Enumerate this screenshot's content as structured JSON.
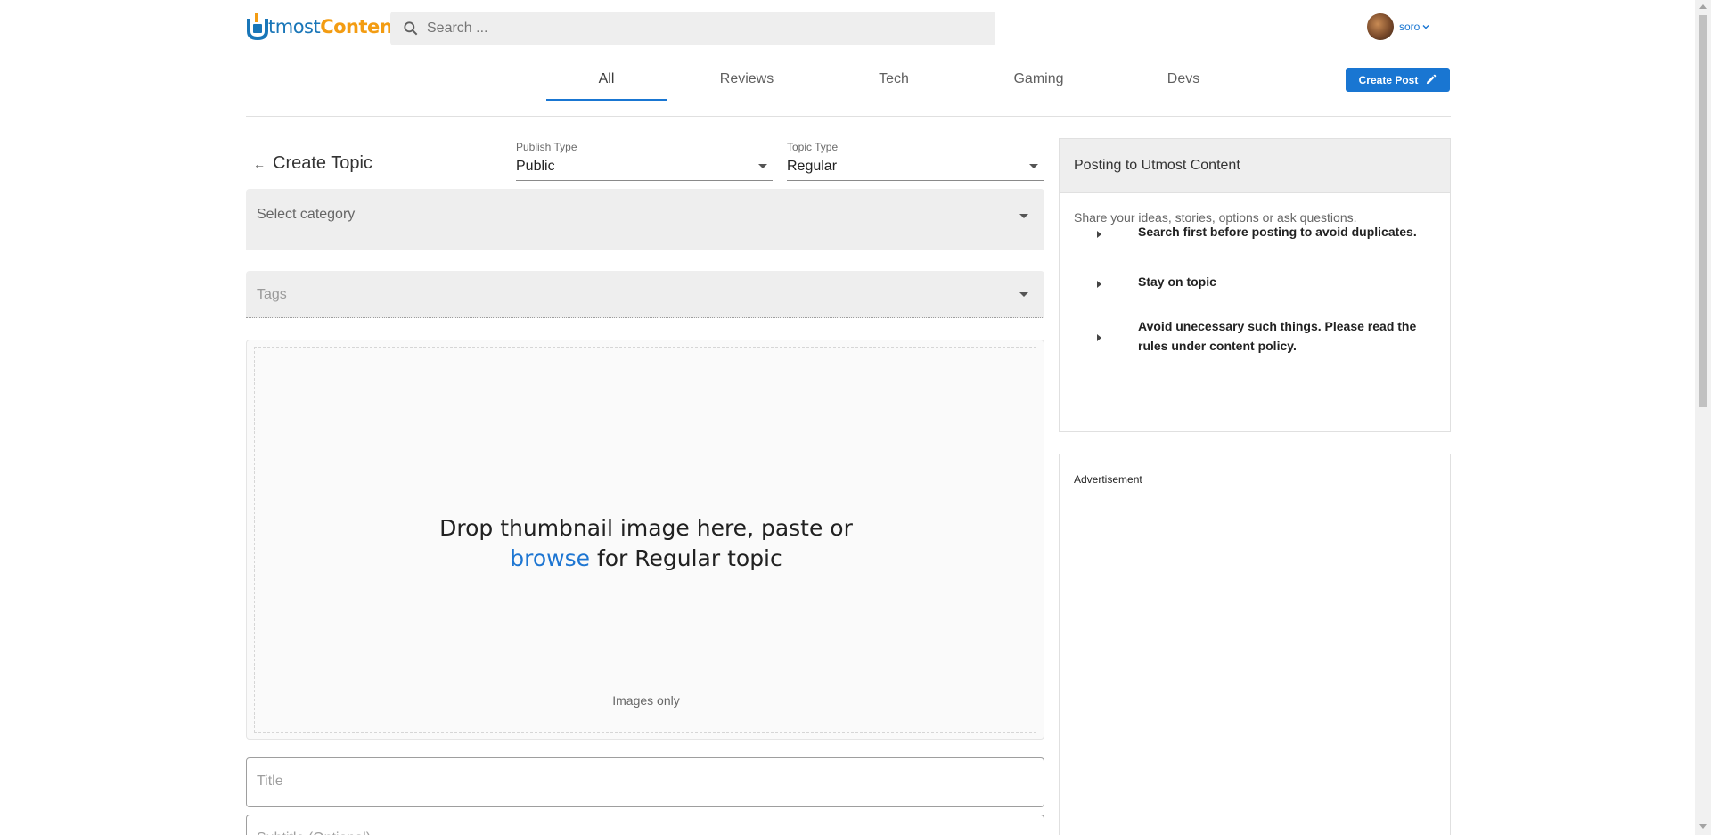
{
  "header": {
    "logo_part1": "tmost",
    "logo_part2": "Content",
    "search_placeholder": "Search ...",
    "user_name": "soro",
    "create_post_label": "Create Post"
  },
  "nav": {
    "tabs": [
      {
        "label": "All",
        "active": true
      },
      {
        "label": "Reviews",
        "active": false
      },
      {
        "label": "Tech",
        "active": false
      },
      {
        "label": "Gaming",
        "active": false
      },
      {
        "label": "Devs",
        "active": false
      }
    ]
  },
  "form": {
    "page_title": "Create Topic",
    "publish_type": {
      "label": "Publish Type",
      "value": "Public"
    },
    "topic_type": {
      "label": "Topic Type",
      "value": "Regular"
    },
    "category_placeholder": "Select category",
    "tags_placeholder": "Tags",
    "dropzone": {
      "line1": "Drop thumbnail image here, paste or",
      "browse": "browse",
      "line2": "for Regular topic",
      "hint": "Images only"
    },
    "title_placeholder": "Title",
    "subtitle_placeholder": "Subtitle (Optional)"
  },
  "sidebar": {
    "guide_title": "Posting to Utmost Content",
    "guide_intro": "Share your ideas, stories, options or ask questions.",
    "rules": [
      "Search first before posting to avoid duplicates.",
      "Stay on topic",
      "Avoid unecessary such things. Please read the rules under content policy."
    ],
    "ad_label": "Advertisement"
  },
  "colors": {
    "accent": "#1976d2",
    "logo_orange": "#f39c12",
    "field_fill": "#eeeeee"
  },
  "icons": [
    "search-icon",
    "chevron-down-icon",
    "pencil-icon",
    "back-arrow-icon",
    "caret-right-icon"
  ]
}
